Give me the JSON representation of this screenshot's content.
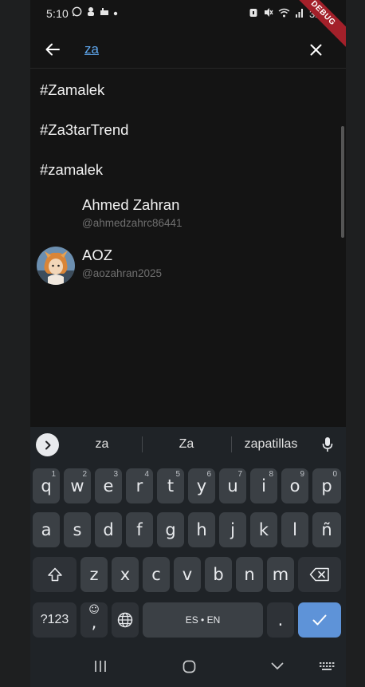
{
  "status": {
    "time": "5:10",
    "battery": "32%",
    "debug": "DEBUG"
  },
  "search": {
    "query": "za"
  },
  "hashtags": [
    "#Zamalek",
    "#Za3tarTrend",
    "#zamalek"
  ],
  "users": [
    {
      "name": "Ahmed Zahran",
      "handle": "@ahmedzahrc86441",
      "has_avatar": false
    },
    {
      "name": "AOZ",
      "handle": "@aozahran2025",
      "has_avatar": true
    }
  ],
  "keyboard": {
    "suggestions": [
      "za",
      "Za",
      "zapatillas"
    ],
    "row1": [
      {
        "k": "q",
        "h": "1"
      },
      {
        "k": "w",
        "h": "2"
      },
      {
        "k": "e",
        "h": "3"
      },
      {
        "k": "r",
        "h": "4"
      },
      {
        "k": "t",
        "h": "5"
      },
      {
        "k": "y",
        "h": "6"
      },
      {
        "k": "u",
        "h": "7"
      },
      {
        "k": "i",
        "h": "8"
      },
      {
        "k": "o",
        "h": "9"
      },
      {
        "k": "p",
        "h": "0"
      }
    ],
    "row2": [
      "a",
      "s",
      "d",
      "f",
      "g",
      "h",
      "j",
      "k",
      "l",
      "ñ"
    ],
    "row3": [
      "z",
      "x",
      "c",
      "v",
      "b",
      "n",
      "m"
    ],
    "symbols_label": "?123",
    "comma": ",",
    "space_label": "ES • EN",
    "period": "."
  },
  "colors": {
    "accent": "#5fa8f0",
    "enter_key": "#5e93d8",
    "debug_ribbon": "#a3202a"
  }
}
